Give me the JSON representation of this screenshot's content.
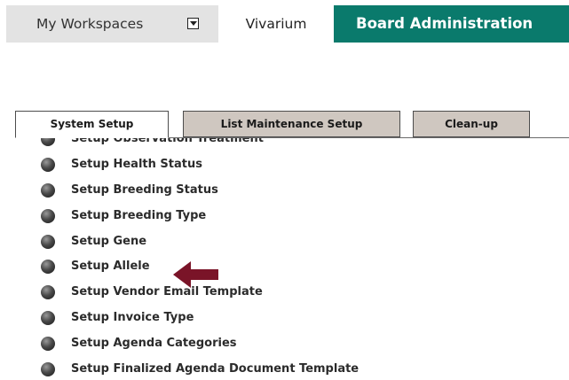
{
  "topnav": {
    "workspaces_label": "My Workspaces",
    "vivarium_label": "Vivarium",
    "board_admin_label": "Board Administration"
  },
  "tabs": [
    {
      "label": "System Setup",
      "active": true
    },
    {
      "label": "List Maintenance Setup",
      "active": false
    },
    {
      "label": "Clean-up",
      "active": false
    }
  ],
  "setup_items": [
    "Setup Observation Treatment",
    "Setup Health Status",
    "Setup Breeding Status",
    "Setup Breeding Type",
    "Setup Gene",
    "Setup Allele",
    "Setup Vendor Email Template",
    "Setup Invoice Type",
    "Setup Agenda Categories",
    "Setup Finalized Agenda Document Template"
  ],
  "annotation": {
    "points_to": "Setup Allele",
    "icon": "left-arrow-icon"
  },
  "colors": {
    "board_admin_bg": "#0a7a6c",
    "workspaces_bg": "#e3e3e3",
    "inactive_tab_bg": "#cfc7c0",
    "arrow": "#7a1428"
  }
}
